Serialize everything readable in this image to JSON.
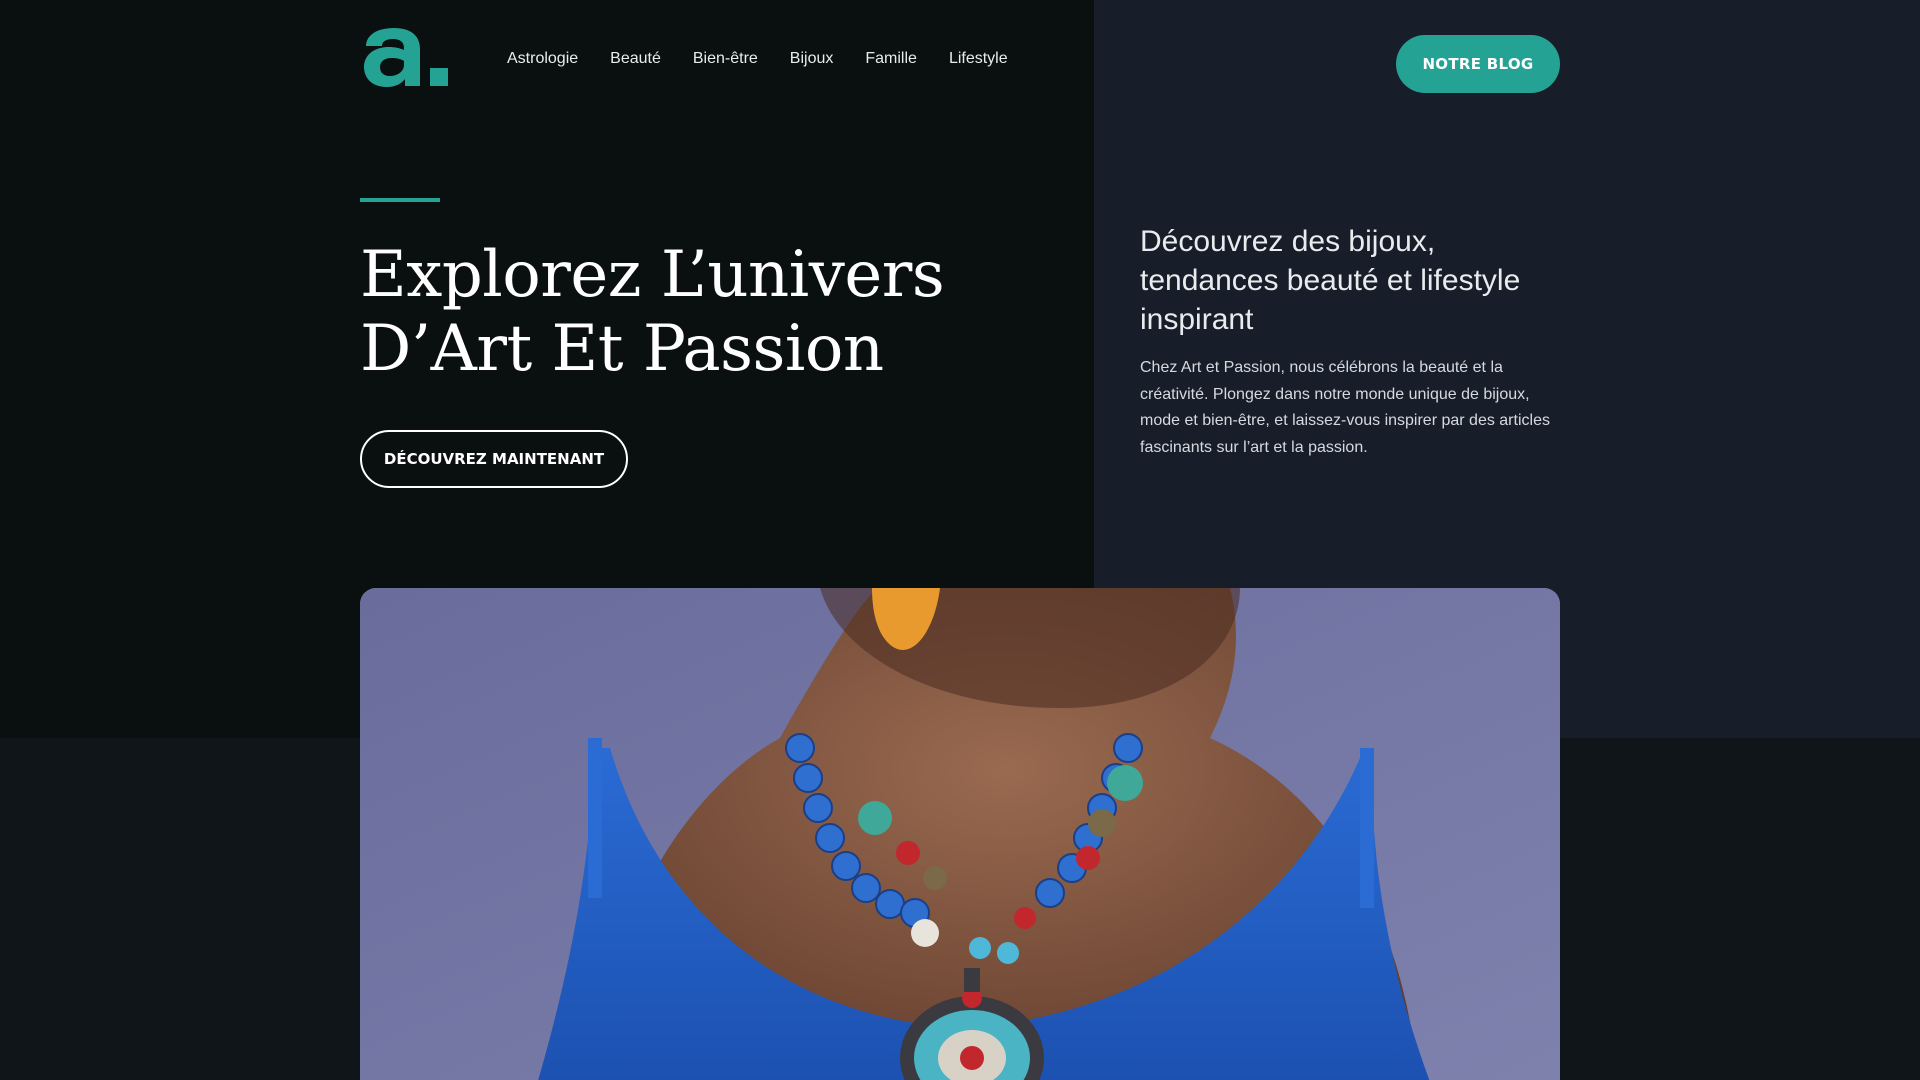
{
  "header": {
    "logo_text": "a.",
    "nav": [
      "Astrologie",
      "Beauté",
      "Bien-être",
      "Bijoux",
      "Famille",
      "Lifestyle"
    ],
    "blog_button": "NOTRE BLOG"
  },
  "hero": {
    "title_line1": "Explorez L’univers",
    "title_line2": "D’Art Et Passion",
    "cta": "DÉCOUVREZ MAINTENANT"
  },
  "intro": {
    "heading": "Découvrez des bijoux, tendances beauté et lifestyle inspirant",
    "text": "Chez Art et Passion, nous célébrons la beauté et la créativité. Plongez dans notre monde unique de bijoux, mode et bien-être, et laissez-vous inspirer par des articles fascinants sur l’art et la passion."
  },
  "colors": {
    "accent": "#24a394",
    "dark_left": "#0a0f0f",
    "dark_right": "#171e29",
    "dark_bottom": "#0f1519"
  }
}
